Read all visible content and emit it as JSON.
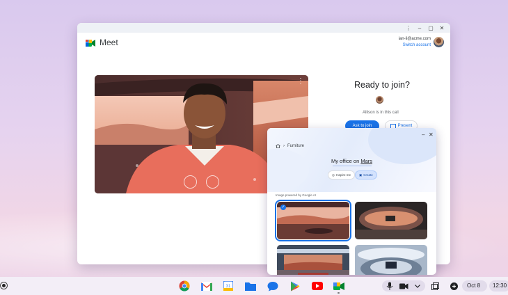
{
  "app": {
    "title": "Meet",
    "account_email": "ian-li@acme.com",
    "switch_account": "Switch account"
  },
  "join": {
    "heading": "Ready to join?",
    "in_call_text": "Allison is in this call",
    "ask_button": "Ask to join",
    "present_button": "Present"
  },
  "background_panel": {
    "breadcrumb": "Furniture",
    "prompt_prefix": "My office on ",
    "prompt_highlight": "Mars",
    "inspire_label": "Inspire me",
    "create_label": "Create",
    "powered_by": "Image powered by Google AI",
    "selected_index": 0
  },
  "taskbar": {
    "date": "Oct 8",
    "time": "12:30",
    "apps": [
      "chrome-icon",
      "gmail-icon",
      "calendar-icon",
      "files-icon",
      "messages-icon",
      "play-store-icon",
      "youtube-icon",
      "meet-icon"
    ]
  },
  "colors": {
    "accent": "#1a73e8"
  }
}
